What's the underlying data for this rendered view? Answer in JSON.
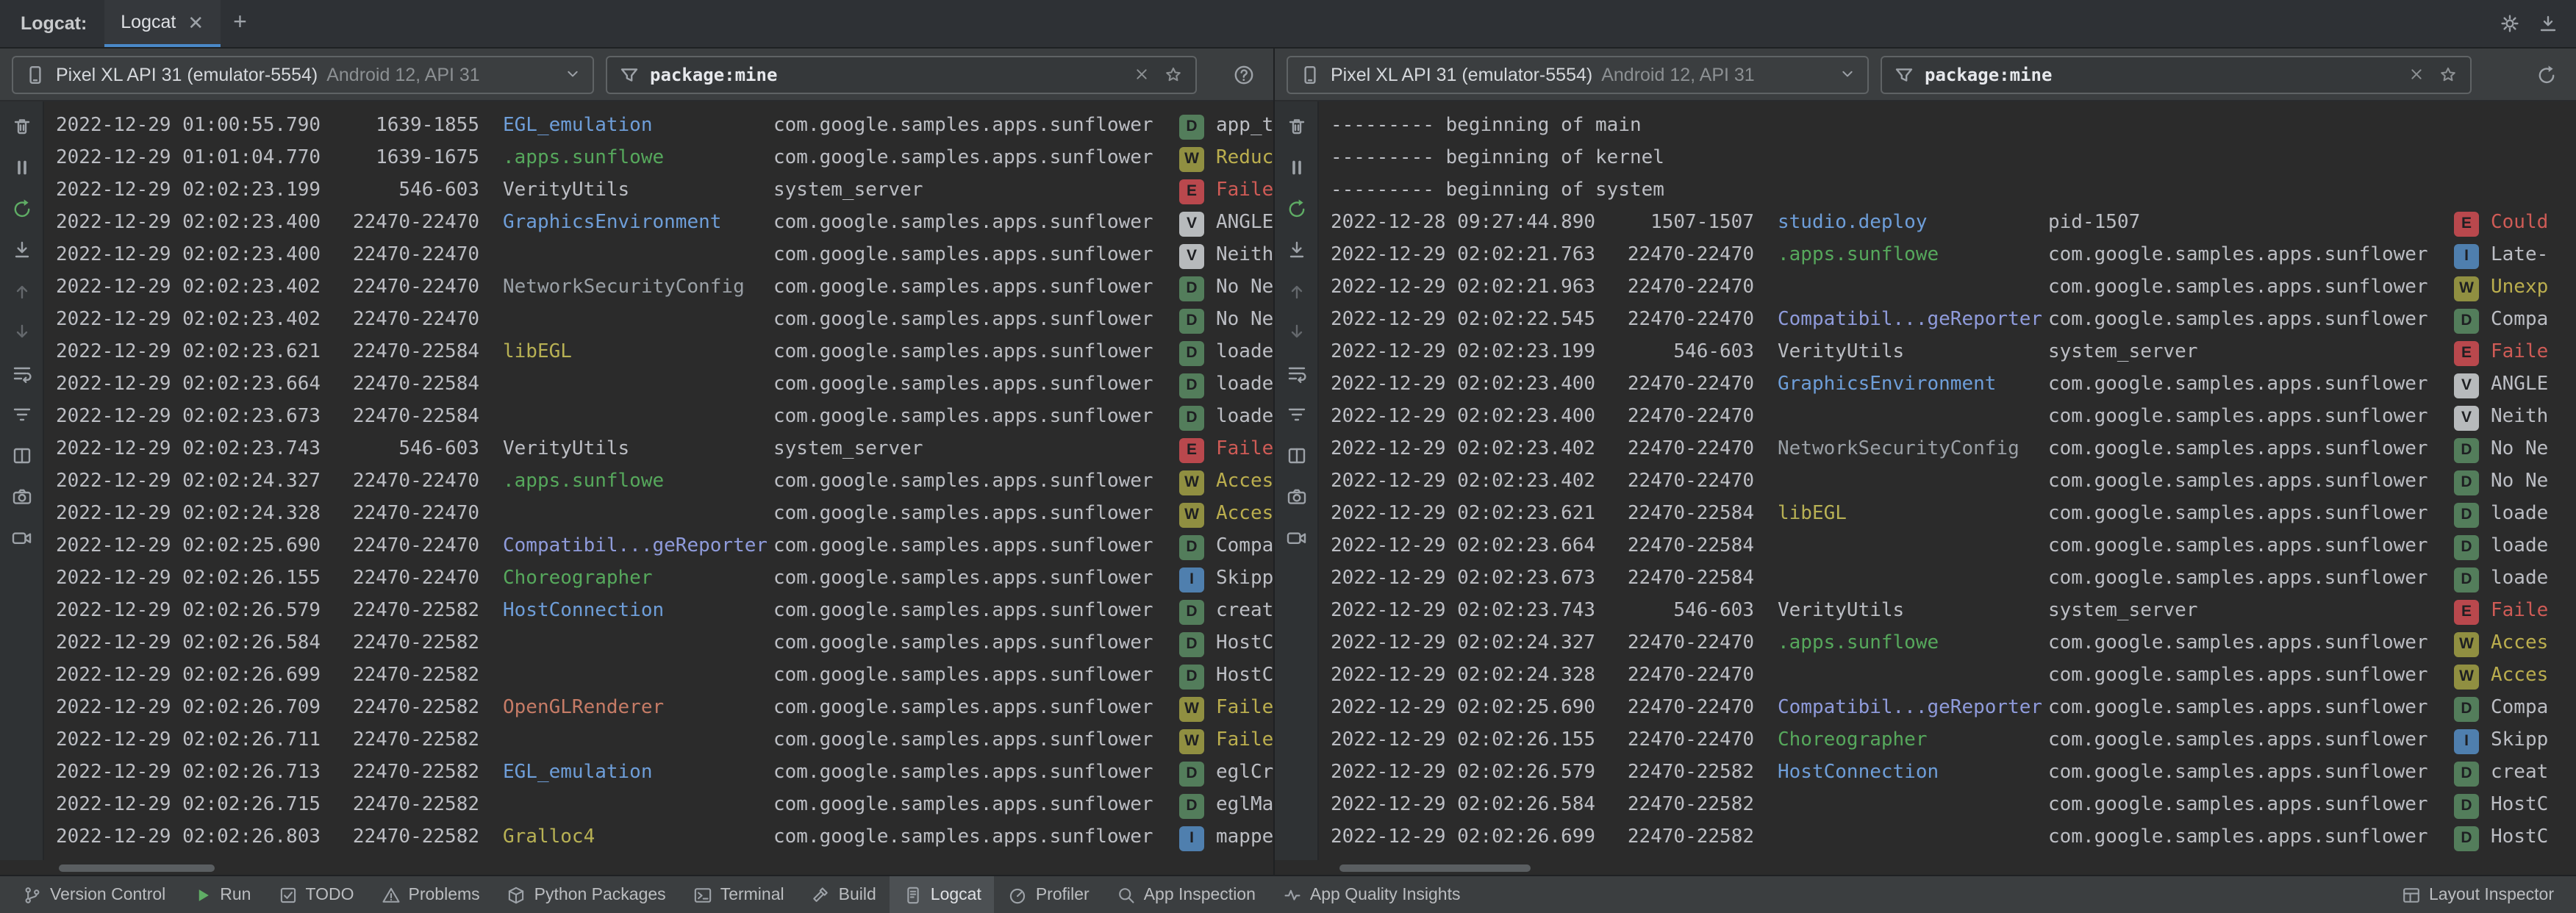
{
  "header": {
    "tool_label": "Logcat:",
    "tab_label": "Logcat",
    "close_glyph": "✕",
    "add_glyph": "+"
  },
  "colors": {
    "accent": "#4a88c7",
    "level_bg": {
      "V": "#b7babc",
      "D": "#537d5b",
      "I": "#4f7fae",
      "W": "#908f41",
      "E": "#b9484d"
    },
    "msg": {
      "W": "#bbae4e",
      "E": "#cf5b56",
      "default": "#bcbec4"
    },
    "tags": {
      "EGL_emulation": "#6e9ed9",
      ".apps.sunflowe": "#56a85c",
      "VerityUtils": "#bcbec4",
      "GraphicsEnvironment": "#6e9ed9",
      "NetworkSecurityConfig": "#9aa0a6",
      "libEGL": "#b8b154",
      "Compatibil...geReporter": "#8f9bdb",
      "Choreographer": "#56a85c",
      "HostConnection": "#6e9ed9",
      "OpenGLRenderer": "#c57b66",
      "Gralloc4": "#b8b154",
      "studio.deploy": "#6e9ed9"
    }
  },
  "side_icons": [
    "clear",
    "pause",
    "restart",
    "scroll-to-end",
    "previous-occurrence",
    "next-occurrence",
    "soft-wrap",
    "collapse",
    "split-panels",
    "screenshot",
    "screen-record"
  ],
  "panes": [
    {
      "device_name": "Pixel XL API 31 (emulator-5554)",
      "device_details": "Android 12, API 31",
      "filter_value": "package:mine",
      "rows": [
        {
          "t": "2022-12-29 01:00:55.790",
          "p": "1639-1855",
          "tag": "EGL_emulation",
          "pkg": "com.google.samples.apps.sunflower",
          "lv": "D",
          "m": "app_t"
        },
        {
          "t": "2022-12-29 01:01:04.770",
          "p": "1639-1675",
          "tag": ".apps.sunflowe",
          "pkg": "com.google.samples.apps.sunflower",
          "lv": "W",
          "m": "Reduc"
        },
        {
          "t": "2022-12-29 02:02:23.199",
          "p": "546-603",
          "tag": "VerityUtils",
          "pkg": "system_server",
          "lv": "E",
          "m": "Faile"
        },
        {
          "t": "2022-12-29 02:02:23.400",
          "p": "22470-22470",
          "tag": "GraphicsEnvironment",
          "pkg": "com.google.samples.apps.sunflower",
          "lv": "V",
          "m": "ANGLE"
        },
        {
          "t": "2022-12-29 02:02:23.400",
          "p": "22470-22470",
          "tag": "",
          "pkg": "com.google.samples.apps.sunflower",
          "lv": "V",
          "m": "Neith"
        },
        {
          "t": "2022-12-29 02:02:23.402",
          "p": "22470-22470",
          "tag": "NetworkSecurityConfig",
          "pkg": "com.google.samples.apps.sunflower",
          "lv": "D",
          "m": "No Ne"
        },
        {
          "t": "2022-12-29 02:02:23.402",
          "p": "22470-22470",
          "tag": "",
          "pkg": "com.google.samples.apps.sunflower",
          "lv": "D",
          "m": "No Ne"
        },
        {
          "t": "2022-12-29 02:02:23.621",
          "p": "22470-22584",
          "tag": "libEGL",
          "pkg": "com.google.samples.apps.sunflower",
          "lv": "D",
          "m": "loade"
        },
        {
          "t": "2022-12-29 02:02:23.664",
          "p": "22470-22584",
          "tag": "",
          "pkg": "com.google.samples.apps.sunflower",
          "lv": "D",
          "m": "loade"
        },
        {
          "t": "2022-12-29 02:02:23.673",
          "p": "22470-22584",
          "tag": "",
          "pkg": "com.google.samples.apps.sunflower",
          "lv": "D",
          "m": "loade"
        },
        {
          "t": "2022-12-29 02:02:23.743",
          "p": "546-603",
          "tag": "VerityUtils",
          "pkg": "system_server",
          "lv": "E",
          "m": "Faile"
        },
        {
          "t": "2022-12-29 02:02:24.327",
          "p": "22470-22470",
          "tag": ".apps.sunflowe",
          "pkg": "com.google.samples.apps.sunflower",
          "lv": "W",
          "m": "Acces"
        },
        {
          "t": "2022-12-29 02:02:24.328",
          "p": "22470-22470",
          "tag": "",
          "pkg": "com.google.samples.apps.sunflower",
          "lv": "W",
          "m": "Acces"
        },
        {
          "t": "2022-12-29 02:02:25.690",
          "p": "22470-22470",
          "tag": "Compatibil...geReporter",
          "pkg": "com.google.samples.apps.sunflower",
          "lv": "D",
          "m": "Compa"
        },
        {
          "t": "2022-12-29 02:02:26.155",
          "p": "22470-22470",
          "tag": "Choreographer",
          "pkg": "com.google.samples.apps.sunflower",
          "lv": "I",
          "m": "Skipp"
        },
        {
          "t": "2022-12-29 02:02:26.579",
          "p": "22470-22582",
          "tag": "HostConnection",
          "pkg": "com.google.samples.apps.sunflower",
          "lv": "D",
          "m": "creat"
        },
        {
          "t": "2022-12-29 02:02:26.584",
          "p": "22470-22582",
          "tag": "",
          "pkg": "com.google.samples.apps.sunflower",
          "lv": "D",
          "m": "HostC"
        },
        {
          "t": "2022-12-29 02:02:26.699",
          "p": "22470-22582",
          "tag": "",
          "pkg": "com.google.samples.apps.sunflower",
          "lv": "D",
          "m": "HostC"
        },
        {
          "t": "2022-12-29 02:02:26.709",
          "p": "22470-22582",
          "tag": "OpenGLRenderer",
          "pkg": "com.google.samples.apps.sunflower",
          "lv": "W",
          "m": "Faile"
        },
        {
          "t": "2022-12-29 02:02:26.711",
          "p": "22470-22582",
          "tag": "",
          "pkg": "com.google.samples.apps.sunflower",
          "lv": "W",
          "m": "Faile"
        },
        {
          "t": "2022-12-29 02:02:26.713",
          "p": "22470-22582",
          "tag": "EGL_emulation",
          "pkg": "com.google.samples.apps.sunflower",
          "lv": "D",
          "m": "eglCr"
        },
        {
          "t": "2022-12-29 02:02:26.715",
          "p": "22470-22582",
          "tag": "",
          "pkg": "com.google.samples.apps.sunflower",
          "lv": "D",
          "m": "eglMa"
        },
        {
          "t": "2022-12-29 02:02:26.803",
          "p": "22470-22582",
          "tag": "Gralloc4",
          "pkg": "com.google.samples.apps.sunflower",
          "lv": "I",
          "m": "mappe"
        }
      ]
    },
    {
      "device_name": "Pixel XL API 31 (emulator-5554)",
      "device_details": "Android 12, API 31",
      "filter_value": "package:mine",
      "rows": [
        {
          "raw": "--------- beginning of main"
        },
        {
          "raw": "--------- beginning of kernel"
        },
        {
          "raw": "--------- beginning of system"
        },
        {
          "t": "2022-12-28 09:27:44.890",
          "p": "1507-1507",
          "tag": "studio.deploy",
          "pkg": "pid-1507",
          "lv": "E",
          "m": "Could"
        },
        {
          "t": "2022-12-29 02:02:21.763",
          "p": "22470-22470",
          "tag": ".apps.sunflowe",
          "pkg": "com.google.samples.apps.sunflower",
          "lv": "I",
          "m": "Late-"
        },
        {
          "t": "2022-12-29 02:02:21.963",
          "p": "22470-22470",
          "tag": "",
          "pkg": "com.google.samples.apps.sunflower",
          "lv": "W",
          "m": "Unexp"
        },
        {
          "t": "2022-12-29 02:02:22.545",
          "p": "22470-22470",
          "tag": "Compatibil...geReporter",
          "pkg": "com.google.samples.apps.sunflower",
          "lv": "D",
          "m": "Compa"
        },
        {
          "t": "2022-12-29 02:02:23.199",
          "p": "546-603",
          "tag": "VerityUtils",
          "pkg": "system_server",
          "lv": "E",
          "m": "Faile"
        },
        {
          "t": "2022-12-29 02:02:23.400",
          "p": "22470-22470",
          "tag": "GraphicsEnvironment",
          "pkg": "com.google.samples.apps.sunflower",
          "lv": "V",
          "m": "ANGLE"
        },
        {
          "t": "2022-12-29 02:02:23.400",
          "p": "22470-22470",
          "tag": "",
          "pkg": "com.google.samples.apps.sunflower",
          "lv": "V",
          "m": "Neith"
        },
        {
          "t": "2022-12-29 02:02:23.402",
          "p": "22470-22470",
          "tag": "NetworkSecurityConfig",
          "pkg": "com.google.samples.apps.sunflower",
          "lv": "D",
          "m": "No Ne"
        },
        {
          "t": "2022-12-29 02:02:23.402",
          "p": "22470-22470",
          "tag": "",
          "pkg": "com.google.samples.apps.sunflower",
          "lv": "D",
          "m": "No Ne"
        },
        {
          "t": "2022-12-29 02:02:23.621",
          "p": "22470-22584",
          "tag": "libEGL",
          "pkg": "com.google.samples.apps.sunflower",
          "lv": "D",
          "m": "loade"
        },
        {
          "t": "2022-12-29 02:02:23.664",
          "p": "22470-22584",
          "tag": "",
          "pkg": "com.google.samples.apps.sunflower",
          "lv": "D",
          "m": "loade"
        },
        {
          "t": "2022-12-29 02:02:23.673",
          "p": "22470-22584",
          "tag": "",
          "pkg": "com.google.samples.apps.sunflower",
          "lv": "D",
          "m": "loade"
        },
        {
          "t": "2022-12-29 02:02:23.743",
          "p": "546-603",
          "tag": "VerityUtils",
          "pkg": "system_server",
          "lv": "E",
          "m": "Faile"
        },
        {
          "t": "2022-12-29 02:02:24.327",
          "p": "22470-22470",
          "tag": ".apps.sunflowe",
          "pkg": "com.google.samples.apps.sunflower",
          "lv": "W",
          "m": "Acces"
        },
        {
          "t": "2022-12-29 02:02:24.328",
          "p": "22470-22470",
          "tag": "",
          "pkg": "com.google.samples.apps.sunflower",
          "lv": "W",
          "m": "Acces"
        },
        {
          "t": "2022-12-29 02:02:25.690",
          "p": "22470-22470",
          "tag": "Compatibil...geReporter",
          "pkg": "com.google.samples.apps.sunflower",
          "lv": "D",
          "m": "Compa"
        },
        {
          "t": "2022-12-29 02:02:26.155",
          "p": "22470-22470",
          "tag": "Choreographer",
          "pkg": "com.google.samples.apps.sunflower",
          "lv": "I",
          "m": "Skipp"
        },
        {
          "t": "2022-12-29 02:02:26.579",
          "p": "22470-22582",
          "tag": "HostConnection",
          "pkg": "com.google.samples.apps.sunflower",
          "lv": "D",
          "m": "creat"
        },
        {
          "t": "2022-12-29 02:02:26.584",
          "p": "22470-22582",
          "tag": "",
          "pkg": "com.google.samples.apps.sunflower",
          "lv": "D",
          "m": "HostC"
        },
        {
          "t": "2022-12-29 02:02:26.699",
          "p": "22470-22582",
          "tag": "",
          "pkg": "com.google.samples.apps.sunflower",
          "lv": "D",
          "m": "HostC"
        }
      ]
    }
  ],
  "status_bar": {
    "active": "Logcat",
    "left": [
      {
        "label": "Version Control",
        "icon": "version-control"
      },
      {
        "label": "Run",
        "icon": "run"
      },
      {
        "label": "TODO",
        "icon": "todo"
      },
      {
        "label": "Problems",
        "icon": "problems"
      },
      {
        "label": "Python Packages",
        "icon": "python-packages"
      },
      {
        "label": "Terminal",
        "icon": "terminal"
      },
      {
        "label": "Build",
        "icon": "build"
      },
      {
        "label": "Logcat",
        "icon": "logcat"
      },
      {
        "label": "Profiler",
        "icon": "profiler"
      },
      {
        "label": "App Inspection",
        "icon": "app-inspection"
      },
      {
        "label": "App Quality Insights",
        "icon": "app-quality-insights"
      }
    ],
    "right": [
      {
        "label": "Layout Inspector",
        "icon": "layout-inspector"
      }
    ]
  }
}
